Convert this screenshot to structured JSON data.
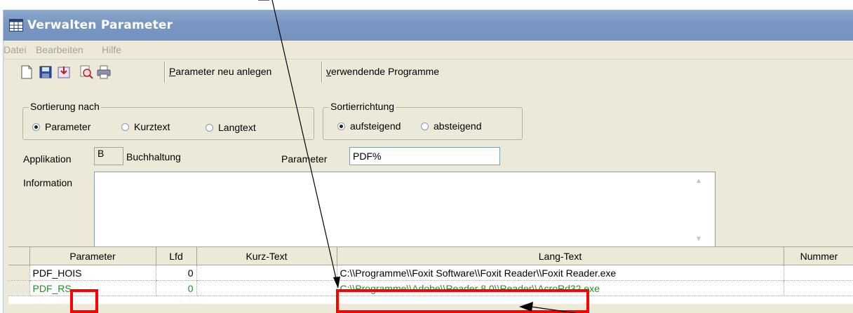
{
  "window": {
    "title": "Verwalten Parameter",
    "colors": {
      "titlebar": "#7b98c4",
      "background": "#ece9d8",
      "highlight": "#ff0000",
      "green_text": "#2a8a2a"
    }
  },
  "menu": {
    "items": [
      "Datei",
      "Bearbeiten",
      "Hilfe"
    ]
  },
  "toolbar": {
    "icons": [
      "new-document-icon",
      "save-icon",
      "import-icon",
      "print-preview-icon",
      "print-icon"
    ],
    "new_param_label": "Parameter neu anlegen",
    "programs_label": "verwendende Programme"
  },
  "sort": {
    "title": "Sortierung nach",
    "options": [
      "Parameter",
      "Kurztext",
      "Langtext"
    ],
    "selected": "Parameter"
  },
  "direction": {
    "title": "Sortierrichtung",
    "options": [
      "aufsteigend",
      "absteigend"
    ],
    "selected": "aufsteigend"
  },
  "form": {
    "applikation_label": "Applikation",
    "applikation_code": "B",
    "applikation_name": "Buchhaltung",
    "parameter_label": "Parameter",
    "parameter_value": "PDF%",
    "information_label": "Information",
    "information_value": ""
  },
  "grid": {
    "columns": [
      "Parameter",
      "Lfd",
      "Kurz-Text",
      "Lang-Text",
      "Nummer"
    ],
    "rows": [
      {
        "parameter": "PDF_HOIS",
        "lfd": "0",
        "kurz": "",
        "lang": "C:\\\\Programme\\\\Foxit Software\\\\Foxit Reader\\\\Foxit Reader.exe",
        "nummer": ""
      },
      {
        "parameter": "PDF_RS",
        "lfd": "0",
        "kurz": "",
        "lang": "C:\\\\Programme\\\\Adobe\\\\Reader 8.0\\\\Reader\\\\AcroRd32.exe",
        "nummer": ""
      }
    ]
  }
}
